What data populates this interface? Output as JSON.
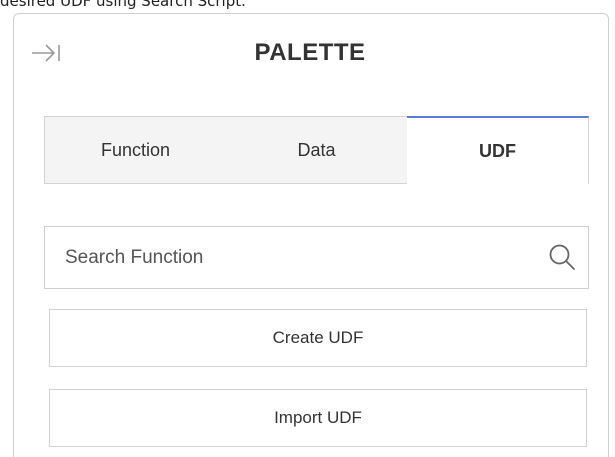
{
  "caption": "desired UDF using Search Script.",
  "palette": {
    "title": "PALETTE",
    "tabs": [
      {
        "label": "Function",
        "active": false
      },
      {
        "label": "Data",
        "active": false
      },
      {
        "label": "UDF",
        "active": true
      }
    ],
    "search": {
      "placeholder": "Search Function",
      "value": "",
      "icon": "search-icon"
    },
    "buttons": {
      "create_label": "Create UDF",
      "import_label": "Import UDF"
    },
    "icons": {
      "collapse": "collapse-panel-icon"
    },
    "colors": {
      "active_tab_accent": "#5a7dd8",
      "inactive_tab_bg": "#f4f4f4",
      "border": "#d3d3d3",
      "text": "#333333"
    }
  }
}
